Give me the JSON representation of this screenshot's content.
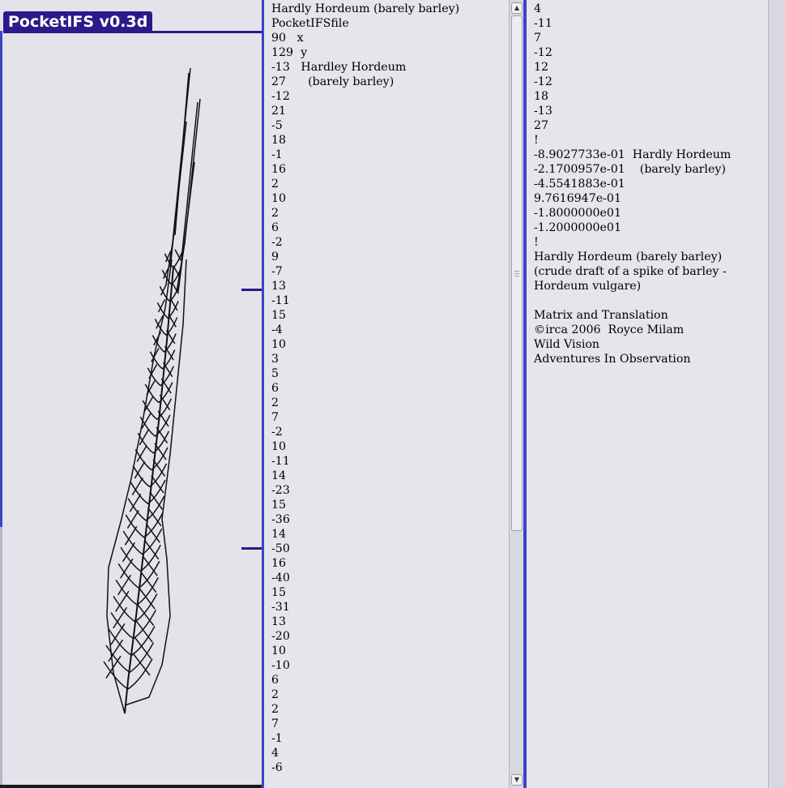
{
  "app": {
    "title": "PocketIFS v0.3d"
  },
  "colors": {
    "title_bg": "#2a1a8a",
    "frame_blue": "#3a44c8",
    "pane_bg": "#e5e5ec"
  },
  "params_pane": {
    "lines": [
      "Hardly Hordeum (barely barley)",
      "PocketIFSfile",
      "90   x",
      "129  y",
      "-13   Hardley Hordeum",
      "27      (barely barley)",
      "-12",
      "21",
      "-5",
      "18",
      "-1",
      "16",
      "2",
      "10",
      "2",
      "6",
      "-2",
      "9",
      "-7",
      "13",
      "-11",
      "15",
      "-4",
      "10",
      "3",
      "5",
      "6",
      "2",
      "7",
      "-2",
      "10",
      "-11",
      "14",
      "-23",
      "15",
      "-36",
      "14",
      "-50",
      "16",
      "-40",
      "15",
      "-31",
      "13",
      "-20",
      "10",
      "-10",
      "6",
      "2",
      "2",
      "7",
      "-1",
      "4",
      "-6"
    ]
  },
  "matrix_pane": {
    "lines": [
      "4",
      "-11",
      "7",
      "-12",
      "12",
      "-12",
      "18",
      "-13",
      "27",
      "!",
      "-8.9027733e-01  Hardly Hordeum",
      "-2.1700957e-01    (barely barley)",
      "-4.5541883e-01",
      "9.7616947e-01",
      "-1.8000000e01",
      "-1.2000000e01",
      "!",
      "Hardly Hordeum (barely barley)",
      "(crude draft of a spike of barley -",
      "Hordeum vulgare)",
      "",
      "Matrix and Translation",
      "©irca 2006  Royce Milam",
      "Wild Vision",
      "Adventures In Observation"
    ]
  },
  "scrollbars": {
    "up_arrow": "▲",
    "down_arrow": "▼"
  }
}
